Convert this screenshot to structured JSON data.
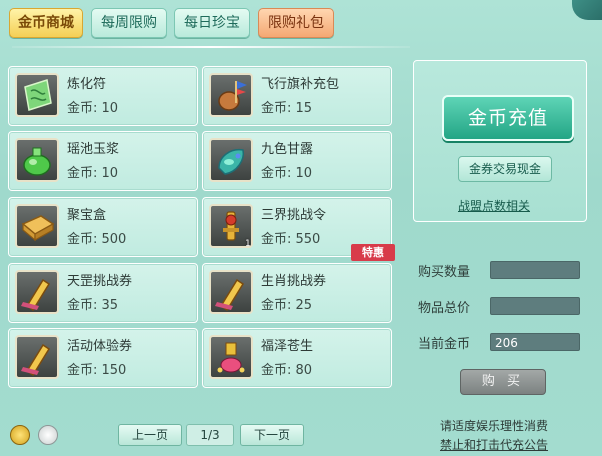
{
  "tabs": [
    {
      "label": "金币商城",
      "active": true
    },
    {
      "label": "每周限购",
      "active": false
    },
    {
      "label": "每日珍宝",
      "active": false
    },
    {
      "label": "限购礼包",
      "active": false
    }
  ],
  "items": [
    {
      "name": "炼化符",
      "price": "金币: 10",
      "icon": "talisman-icon"
    },
    {
      "name": "飞行旗补充包",
      "price": "金币: 15",
      "icon": "flag-bag-icon"
    },
    {
      "name": "瑶池玉浆",
      "price": "金币: 10",
      "icon": "jade-pot-icon"
    },
    {
      "name": "九色甘露",
      "price": "金币: 10",
      "icon": "nectar-icon"
    },
    {
      "name": "聚宝盒",
      "price": "金币: 500",
      "icon": "treasure-box-icon"
    },
    {
      "name": "三界挑战令",
      "price": "金币: 550",
      "icon": "token-icon",
      "qty": "1",
      "badge": "特惠"
    },
    {
      "name": "天罡挑战券",
      "price": "金币: 35",
      "icon": "scroll-icon"
    },
    {
      "name": "生肖挑战券",
      "price": "金币: 25",
      "icon": "scroll-icon"
    },
    {
      "name": "活动体验券",
      "price": "金币: 150",
      "icon": "scroll-icon"
    },
    {
      "name": "福泽苍生",
      "price": "金币: 80",
      "icon": "lucky-bottle-icon"
    }
  ],
  "right_panel": {
    "recharge_label": "金币充值",
    "exchange_label": "金券交易现金",
    "alliance_label": "战盟点数相关"
  },
  "form": {
    "qty_label": "购买数量",
    "qty_value": "",
    "total_label": "物品总价",
    "total_value": "",
    "current_label": "当前金币",
    "current_value": "206"
  },
  "buy_label": "购 买",
  "pager": {
    "prev": "上一页",
    "page": "1/3",
    "next": "下一页"
  },
  "notice": {
    "line1": "请适度娱乐理性消费",
    "line2": "禁止和打击代充公告"
  },
  "colors": {
    "accent_tab": "#f4cf55",
    "recharge_button": "#23a585",
    "badge": "#d83b4a"
  }
}
